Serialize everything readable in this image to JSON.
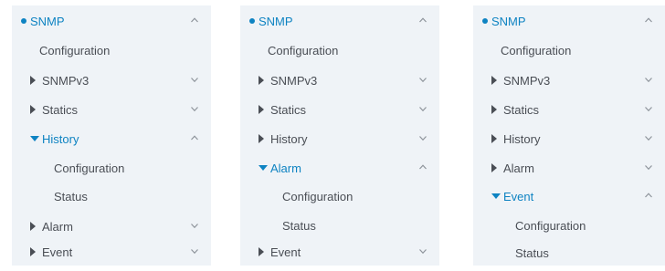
{
  "panels": [
    {
      "root": "SNMP",
      "items": [
        "Configuration",
        "SNMPv3",
        "Statics",
        "History",
        "Configuration",
        "Status",
        "Alarm",
        "Event"
      ]
    },
    {
      "root": "SNMP",
      "items": [
        "Configuration",
        "SNMPv3",
        "Statics",
        "History",
        "Alarm",
        "Configuration",
        "Status",
        "Event"
      ]
    },
    {
      "root": "SNMP",
      "items": [
        "Configuration",
        "SNMPv3",
        "Statics",
        "History",
        "Alarm",
        "Event",
        "Configuration",
        "Status"
      ]
    }
  ],
  "colors": {
    "accent": "#0e83c2",
    "panel_bg": "#eff3f7",
    "text": "#4a4e55",
    "chevron": "#8e949b"
  },
  "icons": {
    "expanded": "chevron-up-icon",
    "collapsed": "chevron-down-icon",
    "root_marker": "bullet-dot-icon",
    "collapsed_marker": "triangle-right-icon",
    "expanded_marker": "triangle-down-icon"
  }
}
